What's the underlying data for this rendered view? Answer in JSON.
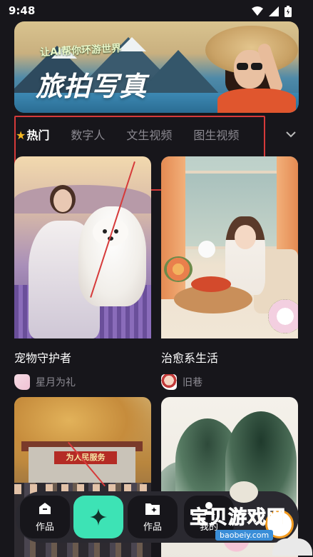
{
  "status_bar": {
    "time": "9:48"
  },
  "banner": {
    "subtitle": "让AI帮你环游世界",
    "title": "旅拍写真"
  },
  "tabs": [
    {
      "label": "热门",
      "active": true,
      "icon": "star-icon"
    },
    {
      "label": "数字人",
      "active": false
    },
    {
      "label": "文生视频",
      "active": false
    },
    {
      "label": "图生视频",
      "active": false
    }
  ],
  "cards": [
    {
      "title": "宠物守护者",
      "author": "星月为礼"
    },
    {
      "title": "治愈系生活",
      "author": "旧巷"
    }
  ],
  "card_images": {
    "school_sign": "为人民服务"
  },
  "bottom_nav": {
    "item1_label": "作品",
    "item3_label": "作品",
    "item4_label": "我的"
  },
  "watermark": {
    "title": "宝贝游戏网",
    "url": "baobeiy.com"
  },
  "colors": {
    "accent": "#3de3b5",
    "highlight_box": "#d63a3a",
    "star": "#f5b824"
  }
}
